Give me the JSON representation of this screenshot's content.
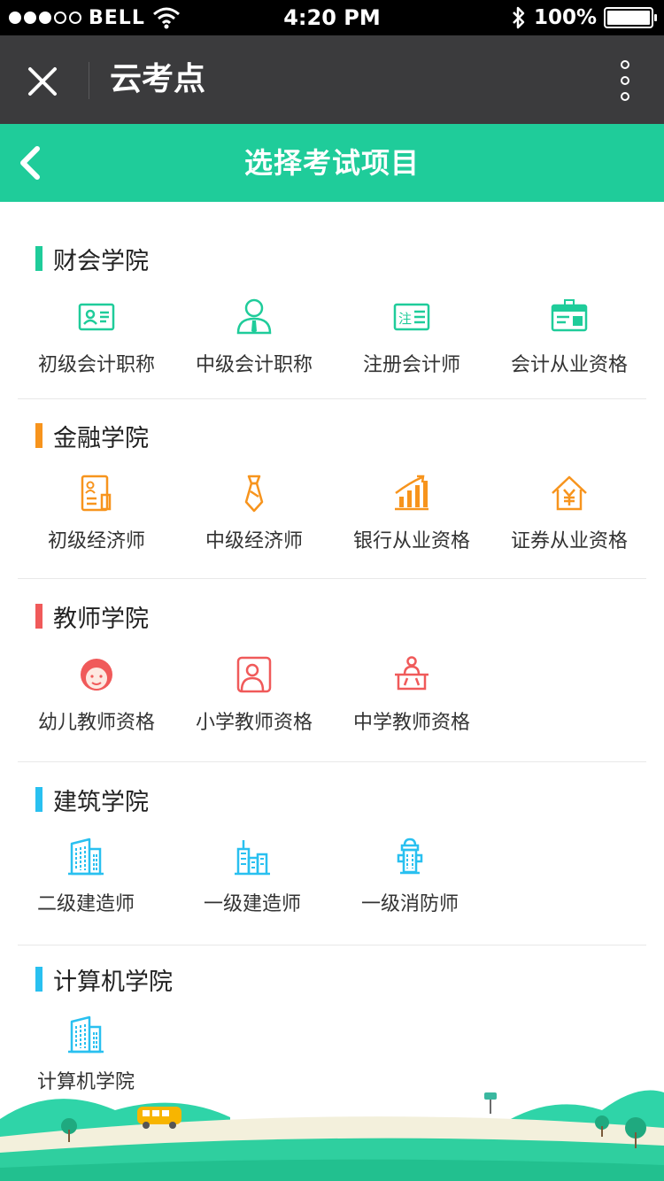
{
  "status_bar": {
    "carrier": "BELL",
    "time": "4:20 PM",
    "battery": "100%",
    "signal_icon": "signal-dots-icon",
    "wifi_icon": "wifi-icon",
    "bluetooth_icon": "bluetooth-icon"
  },
  "wechat_nav": {
    "title": "云考点",
    "close_icon": "close-icon",
    "more_icon": "more-vertical-icon"
  },
  "header": {
    "title": "选择考试项目",
    "back_icon": "back-chevron-icon",
    "color": "#1fcc9a"
  },
  "sections": [
    {
      "title": "财会学院",
      "color": "#1fcc9a",
      "items": [
        {
          "label": "初级会计职称",
          "icon": "id-card-icon"
        },
        {
          "label": "中级会计职称",
          "icon": "person-tie-icon"
        },
        {
          "label": "注册会计师",
          "icon": "register-card-icon"
        },
        {
          "label": "会计从业资格",
          "icon": "certificate-badge-icon"
        }
      ]
    },
    {
      "title": "金融学院",
      "color": "#f7941d",
      "items": [
        {
          "label": "初级经济师",
          "icon": "document-person-icon"
        },
        {
          "label": "中级经济师",
          "icon": "necktie-icon"
        },
        {
          "label": "银行从业资格",
          "icon": "bar-chart-icon"
        },
        {
          "label": "证券从业资格",
          "icon": "yen-house-icon"
        }
      ]
    },
    {
      "title": "教师学院",
      "color": "#f05a5a",
      "items": [
        {
          "label": "幼儿教师资格",
          "icon": "child-face-icon"
        },
        {
          "label": "小学教师资格",
          "icon": "teacher-portrait-icon"
        },
        {
          "label": "中学教师资格",
          "icon": "lectern-icon"
        }
      ]
    },
    {
      "title": "建筑学院",
      "color": "#29c0f0",
      "items": [
        {
          "label": "二级建造师",
          "icon": "building-icon"
        },
        {
          "label": "一级建造师",
          "icon": "city-buildings-icon"
        },
        {
          "label": "一级消防师",
          "icon": "fire-hydrant-icon"
        }
      ]
    },
    {
      "title": "计算机学院",
      "color": "#29c0f0",
      "items": [
        {
          "label": "计算机学院",
          "icon": "building-icon"
        }
      ]
    }
  ]
}
